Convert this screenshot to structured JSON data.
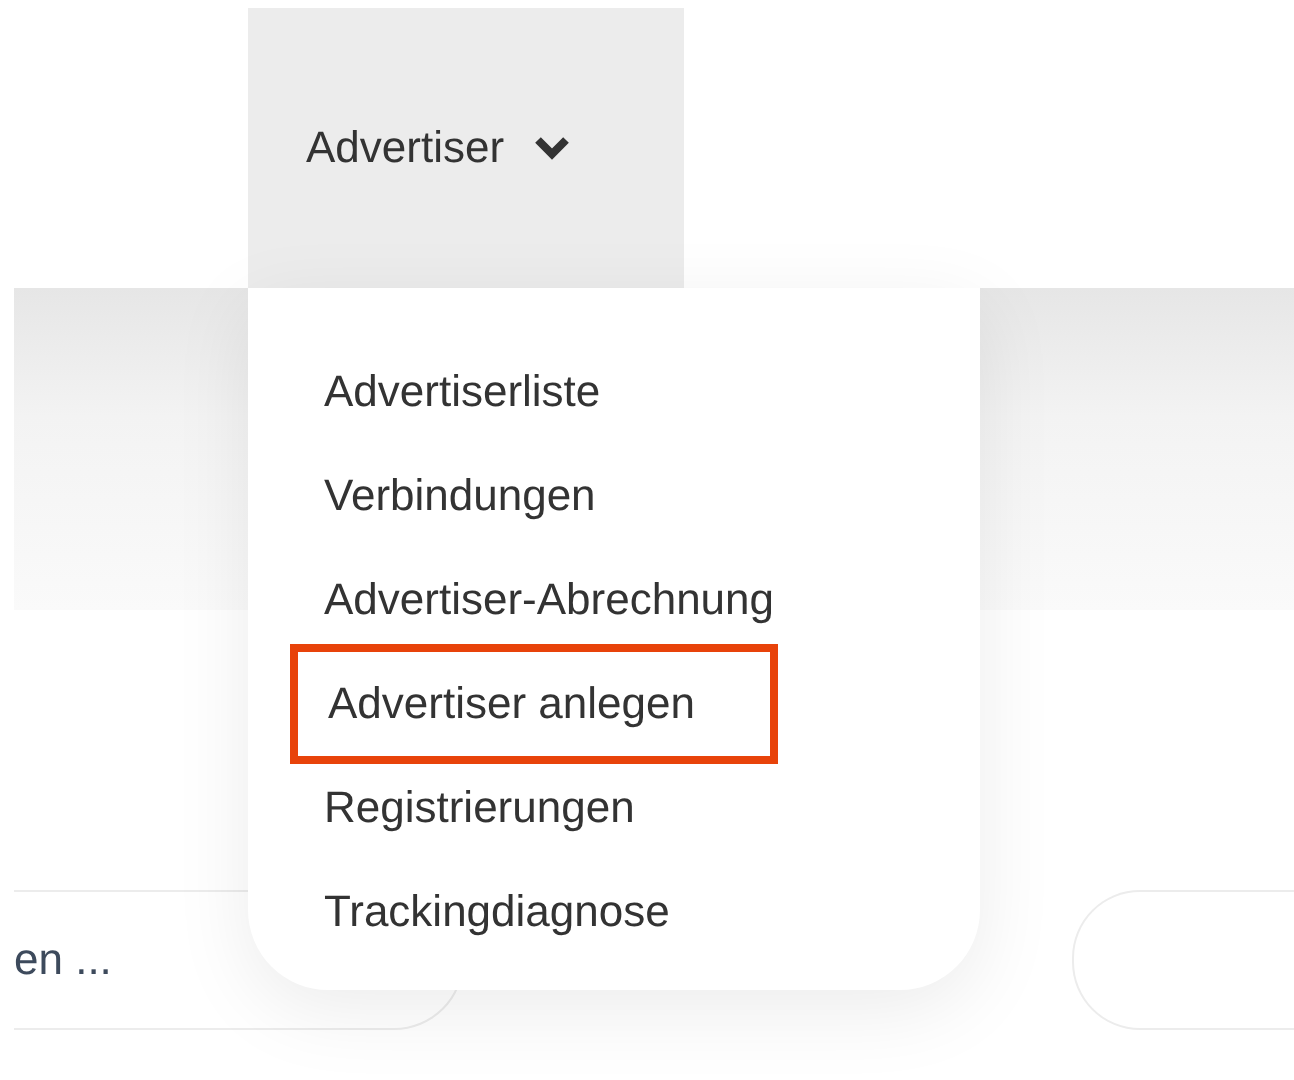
{
  "nav": {
    "label": "Advertiser"
  },
  "menu": {
    "items": [
      {
        "label": "Advertiserliste",
        "highlighted": false
      },
      {
        "label": "Verbindungen",
        "highlighted": false
      },
      {
        "label": "Advertiser-Abrechnung",
        "highlighted": false
      },
      {
        "label": "Advertiser anlegen",
        "highlighted": true
      },
      {
        "label": "Registrierungen",
        "highlighted": false
      },
      {
        "label": "Trackingdiagnose",
        "highlighted": false
      }
    ]
  },
  "search": {
    "placeholder": "en ..."
  }
}
